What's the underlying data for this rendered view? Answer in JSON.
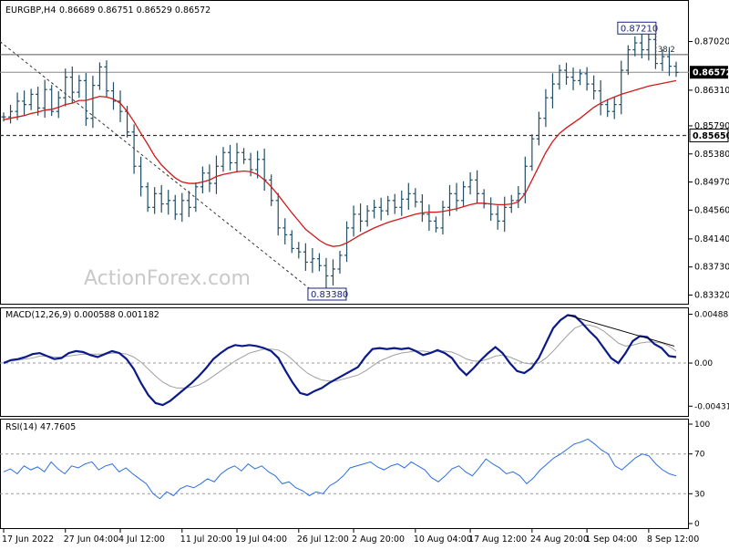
{
  "header": {
    "symbol": "EURGBP,H4",
    "ohlc": "0.86689 0.86751 0.86529 0.86572"
  },
  "watermark": "ActionForex.com",
  "colors": {
    "candle": "#1f4e66",
    "ma": "#d11a1a",
    "macd": "#0b1a8a",
    "signal": "#a0a0a0",
    "rsi": "#2c6fe0",
    "axis": "#000000",
    "dash": "#333333"
  },
  "chart_data": [
    {
      "type": "line",
      "panel": "price",
      "title": "EURGBP,H4",
      "ylim": [
        0.8326,
        0.8752
      ],
      "y_ticks": [
        "0.87020",
        "0.86310",
        "0.85790",
        "0.85380",
        "0.84970",
        "0.84560",
        "0.84140",
        "0.83730",
        "0.83320"
      ],
      "y_tick_values": [
        0.8702,
        0.8631,
        0.8579,
        0.8538,
        0.8497,
        0.8456,
        0.8414,
        0.8373,
        0.8332
      ],
      "x_tick_labels": [
        "17 Jun 2022",
        "27 Jun 04:00",
        "4 Jul 12:00",
        "11 Jul 20:00",
        "19 Jul 04:00",
        "26 Jul 12:00",
        "2 Aug 20:00",
        "10 Aug 04:00",
        "17 Aug 12:00",
        "24 Aug 20:00",
        "1 Sep 04:00",
        "8 Sep 12:00"
      ],
      "x_tick_positions": [
        0,
        9,
        17,
        26,
        34,
        43,
        51,
        60,
        68,
        77,
        85,
        94
      ],
      "close_series": [
        0.8592,
        0.86,
        0.8615,
        0.861,
        0.8625,
        0.8605,
        0.8632,
        0.86,
        0.862,
        0.865,
        0.8628,
        0.8645,
        0.859,
        0.8638,
        0.8665,
        0.863,
        0.8615,
        0.86,
        0.857,
        0.852,
        0.849,
        0.846,
        0.848,
        0.8465,
        0.847,
        0.845,
        0.847,
        0.846,
        0.849,
        0.851,
        0.8495,
        0.852,
        0.854,
        0.8525,
        0.854,
        0.853,
        0.8515,
        0.853,
        0.85,
        0.847,
        0.843,
        0.842,
        0.84,
        0.8395,
        0.838,
        0.8385,
        0.8375,
        0.836,
        0.837,
        0.839,
        0.843,
        0.845,
        0.844,
        0.8455,
        0.846,
        0.8455,
        0.847,
        0.846,
        0.8472,
        0.848,
        0.8468,
        0.845,
        0.844,
        0.843,
        0.846,
        0.848,
        0.847,
        0.849,
        0.85,
        0.848,
        0.8465,
        0.845,
        0.844,
        0.846,
        0.847,
        0.848,
        0.852,
        0.856,
        0.859,
        0.862,
        0.864,
        0.866,
        0.865,
        0.8645,
        0.8655,
        0.864,
        0.863,
        0.861,
        0.86,
        0.861,
        0.866,
        0.869,
        0.87,
        0.869,
        0.8705,
        0.867,
        0.868,
        0.8666,
        0.8657
      ],
      "ma_series": [
        0.8588,
        0.859,
        0.8592,
        0.8594,
        0.8597,
        0.8599,
        0.8602,
        0.8603,
        0.8606,
        0.861,
        0.8612,
        0.8616,
        0.8616,
        0.8619,
        0.8622,
        0.8621,
        0.8618,
        0.8612,
        0.86,
        0.8585,
        0.8568,
        0.8552,
        0.8535,
        0.8522,
        0.8512,
        0.8503,
        0.8497,
        0.8495,
        0.8495,
        0.8497,
        0.85,
        0.8505,
        0.8508,
        0.851,
        0.8512,
        0.8513,
        0.8512,
        0.8508,
        0.85,
        0.849,
        0.8478,
        0.8465,
        0.8452,
        0.844,
        0.8428,
        0.842,
        0.8412,
        0.8406,
        0.8403,
        0.8404,
        0.8408,
        0.8414,
        0.842,
        0.8425,
        0.843,
        0.8434,
        0.8438,
        0.8441,
        0.8444,
        0.8447,
        0.845,
        0.8452,
        0.8453,
        0.8453,
        0.8454,
        0.8456,
        0.8458,
        0.8461,
        0.8464,
        0.8466,
        0.8466,
        0.8465,
        0.8464,
        0.8464,
        0.8465,
        0.8468,
        0.848,
        0.85,
        0.852,
        0.854,
        0.8556,
        0.8568,
        0.8576,
        0.8583,
        0.859,
        0.8598,
        0.8606,
        0.8612,
        0.8617,
        0.8621,
        0.8625,
        0.8628,
        0.8631,
        0.8634,
        0.8637,
        0.8639,
        0.8641,
        0.8643,
        0.8645
      ],
      "labels": {
        "current_price": "0.86572",
        "support_level": "0.85650",
        "high": "0.87210",
        "low": "0.83380",
        "fib": "38.2"
      },
      "levels": {
        "current_price": 0.86572,
        "support_level": 0.8565,
        "fib_38_2": 0.8683,
        "high": 0.8721,
        "low": 0.8338
      }
    },
    {
      "type": "line",
      "panel": "macd",
      "title": "MACD(12,26,9) 0.000588 0.001182",
      "ylim": [
        -0.0052,
        0.0053
      ],
      "y_ticks": [
        "0.004885",
        "0.00",
        "-0.004315"
      ],
      "y_tick_values": [
        0.004885,
        0.0,
        -0.004315
      ],
      "macd_series": [
        0.0,
        0.0003,
        0.0004,
        0.0006,
        0.0009,
        0.001,
        0.0007,
        0.0004,
        0.0005,
        0.001,
        0.0012,
        0.0011,
        0.0008,
        0.0006,
        0.0009,
        0.0012,
        0.001,
        0.0004,
        -0.0006,
        -0.002,
        -0.0032,
        -0.004,
        -0.0042,
        -0.0038,
        -0.0032,
        -0.0026,
        -0.002,
        -0.0013,
        -0.0005,
        0.0004,
        0.001,
        0.0015,
        0.0018,
        0.0017,
        0.0018,
        0.0017,
        0.0015,
        0.0012,
        0.0005,
        -0.0008,
        -0.002,
        -0.003,
        -0.0032,
        -0.0028,
        -0.0025,
        -0.002,
        -0.0016,
        -0.0012,
        -0.0008,
        -0.0004,
        0.0006,
        0.0014,
        0.0015,
        0.0014,
        0.0015,
        0.0014,
        0.0015,
        0.0012,
        0.0008,
        0.001,
        0.0013,
        0.001,
        0.0005,
        -0.0005,
        -0.0012,
        -0.0005,
        0.0003,
        0.001,
        0.0016,
        0.001,
        0.0,
        -0.0008,
        -0.001,
        -0.0005,
        0.0005,
        0.002,
        0.0035,
        0.0043,
        0.0048,
        0.0047,
        0.004,
        0.0032,
        0.0025,
        0.0015,
        0.0005,
        0.0,
        0.001,
        0.0022,
        0.0027,
        0.0026,
        0.0019,
        0.0015,
        0.0007,
        0.0006
      ],
      "signal_series": [
        0.0001,
        0.0002,
        0.0003,
        0.0004,
        0.0005,
        0.0007,
        0.0007,
        0.0006,
        0.0006,
        0.0007,
        0.0008,
        0.0009,
        0.0009,
        0.0009,
        0.0009,
        0.001,
        0.001,
        0.0009,
        0.0006,
        0.0001,
        -0.0006,
        -0.0013,
        -0.0019,
        -0.0023,
        -0.0025,
        -0.0025,
        -0.0024,
        -0.0022,
        -0.0018,
        -0.0013,
        -0.0008,
        -0.0003,
        0.0002,
        0.0006,
        0.001,
        0.0012,
        0.0014,
        0.0014,
        0.0013,
        0.0009,
        0.0003,
        -0.0004,
        -0.001,
        -0.0014,
        -0.0017,
        -0.0018,
        -0.0018,
        -0.0016,
        -0.0014,
        -0.0012,
        -0.0008,
        -0.0003,
        0.0002,
        0.0005,
        0.0008,
        0.001,
        0.0011,
        0.0012,
        0.0012,
        0.0011,
        0.0012,
        0.0012,
        0.0011,
        0.0008,
        0.0004,
        0.0002,
        0.0002,
        0.0004,
        0.0007,
        0.0008,
        0.0006,
        0.0003,
        0.0,
        -0.0001,
        0.0,
        0.0005,
        0.0012,
        0.002,
        0.0028,
        0.0035,
        0.0038,
        0.0038,
        0.0036,
        0.0032,
        0.0026,
        0.002,
        0.0017,
        0.0018,
        0.002,
        0.0021,
        0.0021,
        0.002,
        0.0017,
        0.0012
      ]
    },
    {
      "type": "line",
      "panel": "rsi",
      "title": "RSI(14) 47.7605",
      "ylim": [
        0,
        100
      ],
      "y_ticks": [
        "100",
        "70",
        "30",
        "0"
      ],
      "y_tick_values": [
        100,
        70,
        30,
        0
      ],
      "rsi_series": [
        52,
        55,
        50,
        58,
        54,
        57,
        52,
        62,
        55,
        50,
        58,
        56,
        60,
        62,
        54,
        58,
        60,
        52,
        56,
        50,
        45,
        40,
        30,
        25,
        32,
        28,
        35,
        38,
        36,
        40,
        45,
        42,
        50,
        55,
        58,
        53,
        60,
        55,
        58,
        52,
        48,
        40,
        42,
        36,
        33,
        28,
        32,
        30,
        38,
        42,
        48,
        56,
        58,
        60,
        62,
        57,
        54,
        58,
        60,
        56,
        62,
        58,
        54,
        46,
        42,
        48,
        55,
        58,
        52,
        48,
        56,
        65,
        60,
        56,
        50,
        52,
        48,
        40,
        46,
        54,
        60,
        66,
        70,
        75,
        80,
        82,
        85,
        80,
        74,
        70,
        58,
        54,
        60,
        66,
        70,
        68,
        60,
        54,
        50,
        48
      ]
    }
  ]
}
